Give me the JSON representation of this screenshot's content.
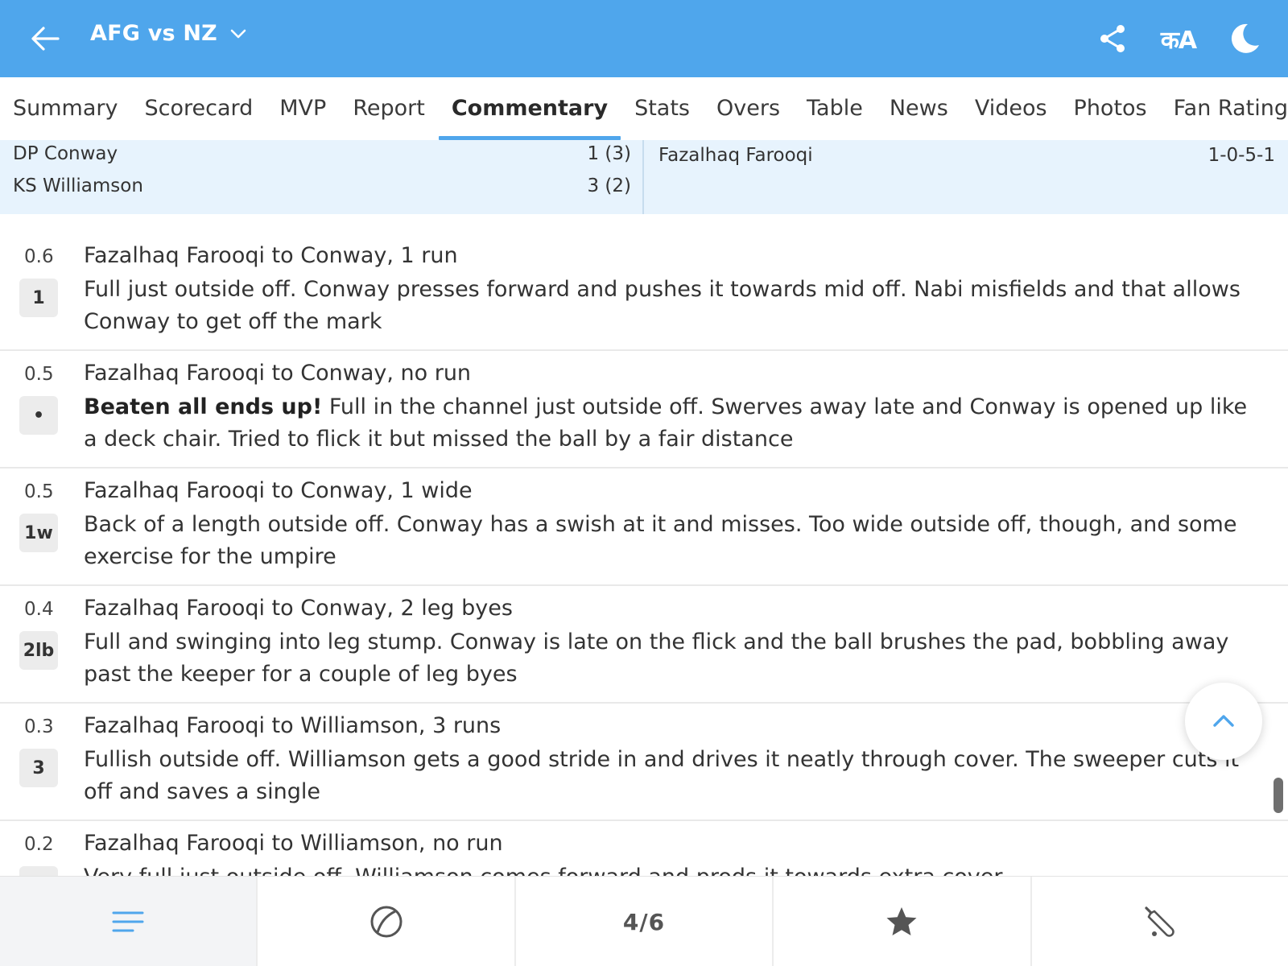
{
  "appbar": {
    "title": "AFG vs NZ",
    "back_icon": "arrow-left-icon",
    "chevron_icon": "chevron-down-icon",
    "share_icon": "share-icon",
    "language_label": "कA",
    "theme_icon": "moon-icon",
    "color": "#4fa6ec"
  },
  "tabs": [
    {
      "label": "Summary"
    },
    {
      "label": "Scorecard"
    },
    {
      "label": "MVP"
    },
    {
      "label": "Report"
    },
    {
      "label": "Commentary",
      "active": true
    },
    {
      "label": "Stats"
    },
    {
      "label": "Overs"
    },
    {
      "label": "Table"
    },
    {
      "label": "News"
    },
    {
      "label": "Videos"
    },
    {
      "label": "Photos"
    },
    {
      "label": "Fan Ratings"
    }
  ],
  "live": {
    "batters": [
      {
        "name": "DP Conway",
        "score": "1 (3)"
      },
      {
        "name": "KS Williamson",
        "score": "3 (2)"
      }
    ],
    "bowler": {
      "name": "Fazalhaq Farooqi",
      "figures": "1-0-5-1"
    }
  },
  "commentary": [
    {
      "over": "0.6",
      "badge": "1",
      "head": "Fazalhaq Farooqi to Conway, 1 run",
      "bold": "",
      "text": "Full just outside off. Conway presses forward and pushes it towards mid off. Nabi misfields and that allows Conway to get off the mark"
    },
    {
      "over": "0.5",
      "badge": "•",
      "head": "Fazalhaq Farooqi to Conway, no run",
      "bold": "Beaten all ends up!",
      "text": " Full in the channel just outside off. Swerves away late and Conway is opened up like a deck chair. Tried to flick it but missed the ball by a fair distance"
    },
    {
      "over": "0.5",
      "badge": "1w",
      "head": "Fazalhaq Farooqi to Conway, 1 wide",
      "bold": "",
      "text": "Back of a length outside off. Conway has a swish at it and misses. Too wide outside off, though, and some exercise for the umpire"
    },
    {
      "over": "0.4",
      "badge": "2lb",
      "head": "Fazalhaq Farooqi to Conway, 2 leg byes",
      "bold": "",
      "text": "Full and swinging into leg stump. Conway is late on the flick and the ball brushes the pad, bobbling away past the keeper for a couple of leg byes"
    },
    {
      "over": "0.3",
      "badge": "3",
      "head": "Fazalhaq Farooqi to Williamson, 3 runs",
      "bold": "",
      "text": "Fullish outside off. Williamson gets a good stride in and drives it neatly through cover. The sweeper cuts it off and saves a single"
    },
    {
      "over": "0.2",
      "badge": "",
      "head": "Fazalhaq Farooqi to Williamson, no run",
      "bold": "",
      "text": "Very full just outside off. Williamson comes forward and prods it towards extra cover"
    }
  ],
  "scroll_top_icon": "chevron-up-icon",
  "bottom_nav": {
    "items": [
      {
        "icon": "menu-lines-icon",
        "active": true
      },
      {
        "icon": "ball-icon"
      },
      {
        "label": "4/6"
      },
      {
        "icon": "star-icon"
      },
      {
        "icon": "cricket-bat-icon"
      }
    ]
  }
}
